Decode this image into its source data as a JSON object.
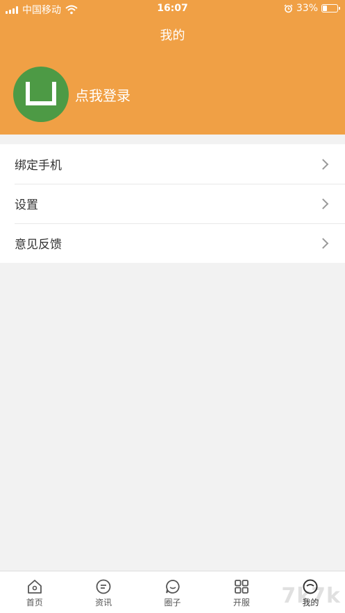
{
  "status_bar": {
    "carrier": "中国移动",
    "time": "16:07",
    "battery": "33%",
    "battery_level": 0.33,
    "icons": [
      "signal-icon",
      "wifi-icon",
      "alarm-icon",
      "battery-icon"
    ]
  },
  "header": {
    "title": "我的",
    "background_color": "#f0a045",
    "avatar_color": "#4d9a45",
    "login_text": "点我登录"
  },
  "menu": {
    "items": [
      {
        "label": "绑定手机"
      },
      {
        "label": "设置"
      },
      {
        "label": "意见反馈"
      }
    ]
  },
  "tabbar": {
    "tabs": [
      {
        "label": "首页",
        "icon": "home-icon"
      },
      {
        "label": "资讯",
        "icon": "news-icon"
      },
      {
        "label": "圈子",
        "icon": "chat-icon"
      },
      {
        "label": "开服",
        "icon": "grid-icon"
      },
      {
        "label": "我的",
        "icon": "profile-icon",
        "active": true
      }
    ]
  },
  "watermark": "7k7k"
}
